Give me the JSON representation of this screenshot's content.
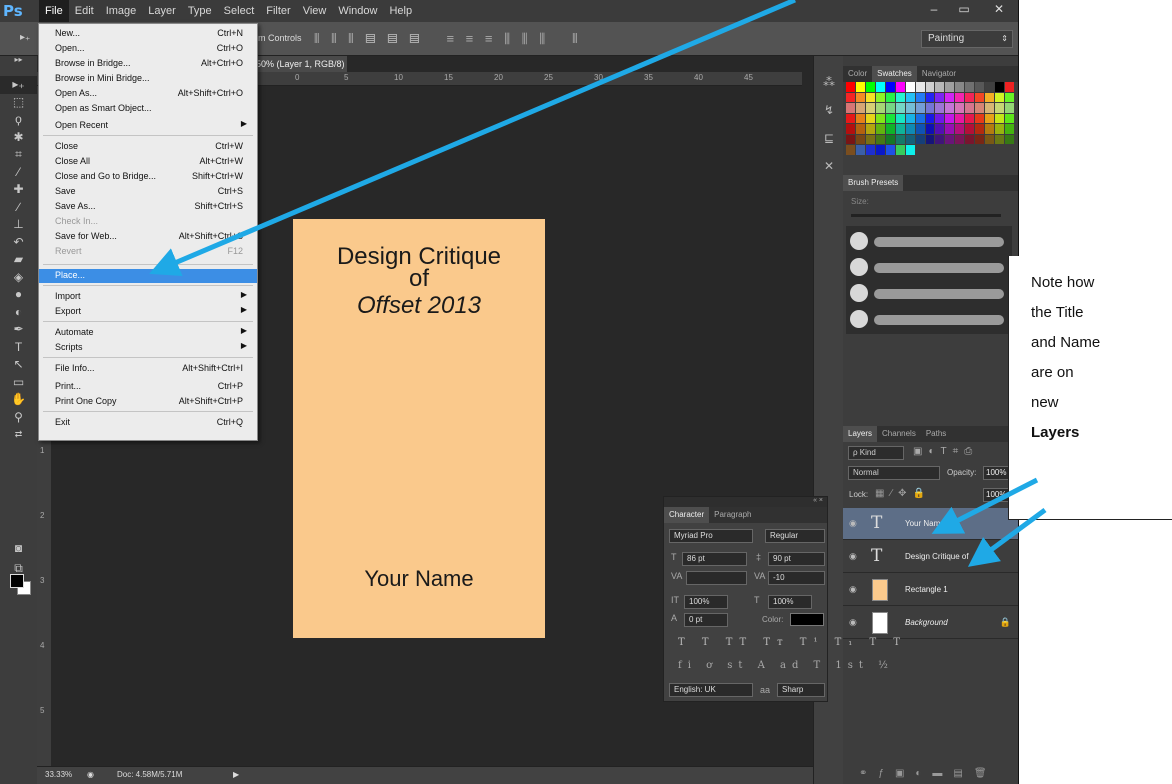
{
  "app": {
    "logo": "Ps",
    "menu": [
      "File",
      "Edit",
      "Image",
      "Layer",
      "Type",
      "Select",
      "Filter",
      "View",
      "Window",
      "Help"
    ],
    "window_controls": [
      "–",
      "▭",
      "✕"
    ]
  },
  "options_bar": {
    "text": "m Controls",
    "workspace": "Painting"
  },
  "doc_tab": {
    "label": "50% (Layer 1, RGB/8) *  ×"
  },
  "ruler_h": [
    "0",
    "5",
    "10",
    "15",
    "20",
    "25",
    "30",
    "35",
    "40",
    "45"
  ],
  "ruler_v": [
    "1",
    "2",
    "3",
    "4",
    "5"
  ],
  "file_menu": [
    {
      "label": "New...",
      "shortcut": "Ctrl+N"
    },
    {
      "label": "Open...",
      "shortcut": "Ctrl+O"
    },
    {
      "label": "Browse in Bridge...",
      "shortcut": "Alt+Ctrl+O"
    },
    {
      "label": "Browse in Mini Bridge...",
      "shortcut": ""
    },
    {
      "label": "Open As...",
      "shortcut": "Alt+Shift+Ctrl+O"
    },
    {
      "label": "Open as Smart Object...",
      "shortcut": ""
    },
    {
      "label": "Open Recent",
      "shortcut": ""
    },
    {
      "label": "Close",
      "shortcut": "Ctrl+W"
    },
    {
      "label": "Close All",
      "shortcut": "Alt+Ctrl+W"
    },
    {
      "label": "Close and Go to Bridge...",
      "shortcut": "Shift+Ctrl+W"
    },
    {
      "label": "Save",
      "shortcut": "Ctrl+S"
    },
    {
      "label": "Save As...",
      "shortcut": "Shift+Ctrl+S"
    },
    {
      "label": "Check In...",
      "shortcut": ""
    },
    {
      "label": "Save for Web...",
      "shortcut": "Alt+Shift+Ctrl+S"
    },
    {
      "label": "Revert",
      "shortcut": "F12"
    },
    {
      "label": "Place...",
      "shortcut": ""
    },
    {
      "label": "Import",
      "shortcut": ""
    },
    {
      "label": "Export",
      "shortcut": ""
    },
    {
      "label": "Automate",
      "shortcut": ""
    },
    {
      "label": "Scripts",
      "shortcut": ""
    },
    {
      "label": "File Info...",
      "shortcut": "Alt+Shift+Ctrl+I"
    },
    {
      "label": "Print...",
      "shortcut": "Ctrl+P"
    },
    {
      "label": "Print One Copy",
      "shortcut": "Alt+Shift+Ctrl+P"
    },
    {
      "label": "Exit",
      "shortcut": "Ctrl+Q"
    }
  ],
  "canvas": {
    "title": "Design Critique",
    "of": "of",
    "subtitle": "Offset 2013",
    "name": "Your Name",
    "background": "#fac98c"
  },
  "status": {
    "zoom": "33.33%",
    "doc": "Doc: 4.58M/5.71M"
  },
  "panels": {
    "color_tabs": [
      "Color",
      "Swatches",
      "Navigator"
    ],
    "brush_tabs": [
      "Brush Presets"
    ],
    "brush_size_label": "Size:",
    "layers_tabs": [
      "Layers",
      "Channels",
      "Paths"
    ],
    "kind": "ρ Kind",
    "blend_mode": "Normal",
    "opacity_label": "Opacity:",
    "opacity": "100%",
    "lock_label": "Lock:",
    "fill_value": "100%"
  },
  "layers": [
    {
      "name": "Your Name",
      "type": "text",
      "selected": true
    },
    {
      "name": "Design Critique of",
      "type": "text",
      "selected": false
    },
    {
      "name": "Rectangle 1",
      "type": "shape",
      "color": "#fac98c",
      "selected": false
    },
    {
      "name": "Background",
      "type": "background",
      "color": "#ffffff",
      "selected": false
    }
  ],
  "character_panel": {
    "tabs": [
      "Character",
      "Paragraph"
    ],
    "font": "Myriad Pro",
    "style": "Regular",
    "size": "86 pt",
    "leading": "90 pt",
    "tracking": "-10",
    "vscale": "100%",
    "hscale": "100%",
    "baseline": "0 pt",
    "color_label": "Color:",
    "language": "English: UK",
    "antialias": "Sharp",
    "aa_label": "aa"
  },
  "callout": {
    "lines": [
      "Note how",
      "the Title",
      "and Name",
      "are on",
      "new"
    ],
    "bold_line": "Layers"
  },
  "colors": {
    "accent_arrow": "#1fa9e6",
    "menu_highlight": "#3c8ee5"
  }
}
